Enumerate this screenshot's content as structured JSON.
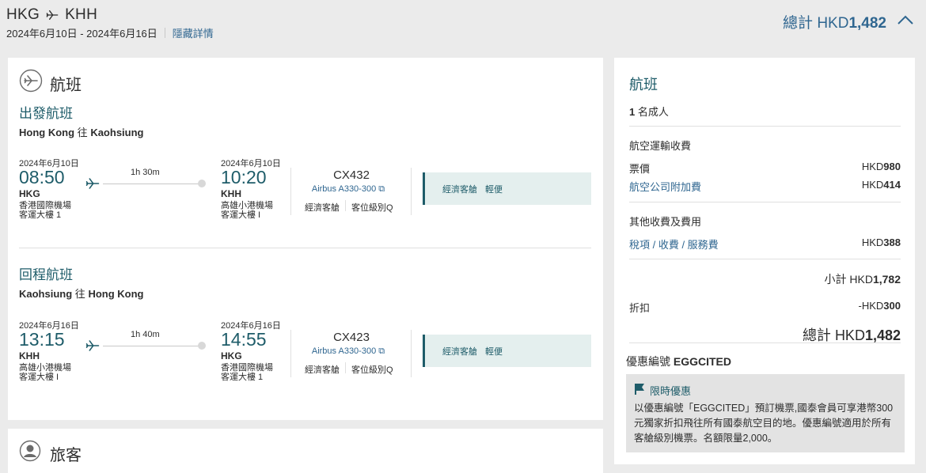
{
  "header": {
    "origin": "HKG",
    "destination": "KHH",
    "date_range": "2024年6月10日 - 2024年6月16日",
    "hide_details_link": "隱藏詳情",
    "total_label": "總計 HKD",
    "total_amount": "1,482"
  },
  "flights_section": {
    "title": "航班",
    "outbound": {
      "title": "出發航班",
      "from": "Hong Kong",
      "connector": "往",
      "to": "Kaohsiung",
      "dep_date": "2024年6月10日",
      "dep_time": "08:50",
      "dep_code": "HKG",
      "dep_airport": "香港國際機場",
      "dep_terminal": "客運大樓 1",
      "duration": "1h 30m",
      "arr_date": "2024年6月10日",
      "arr_time": "10:20",
      "arr_code": "KHH",
      "arr_airport": "高雄小港機場",
      "arr_terminal": "客運大樓 I",
      "flight_no": "CX432",
      "aircraft": "Airbus A330-300",
      "cabin": "經濟客艙",
      "booking_class": "客位級別Q",
      "fare_cabin": "經濟客艙",
      "fare_brand": "輕便"
    },
    "inbound": {
      "title": "回程航班",
      "from": "Kaohsiung",
      "connector": "往",
      "to": "Hong Kong",
      "dep_date": "2024年6月16日",
      "dep_time": "13:15",
      "dep_code": "KHH",
      "dep_airport": "高雄小港機場",
      "dep_terminal": "客運大樓 I",
      "duration": "1h 40m",
      "arr_date": "2024年6月16日",
      "arr_time": "14:55",
      "arr_code": "HKG",
      "arr_airport": "香港國際機場",
      "arr_terminal": "客運大樓 1",
      "flight_no": "CX423",
      "aircraft": "Airbus A330-300",
      "cabin": "經濟客艙",
      "booking_class": "客位級別Q",
      "fare_cabin": "經濟客艙",
      "fare_brand": "輕便"
    }
  },
  "passengers_section": {
    "title": "旅客"
  },
  "summary": {
    "title": "航班",
    "adults_count": "1",
    "adults_label": "名成人",
    "air_transport_heading": "航空運輸收費",
    "fare_label": "票價",
    "fare_currency": "HKD",
    "fare_value": "980",
    "surcharge_label": "航空公司附加費",
    "surcharge_currency": "HKD",
    "surcharge_value": "414",
    "other_heading": "其他收費及費用",
    "taxes_label": "稅項 / 收費 / 服務費",
    "taxes_currency": "HKD",
    "taxes_value": "388",
    "subtotal_label": "小計 HKD",
    "subtotal_value": "1,782",
    "discount_label": "折扣",
    "discount_currency": "-HKD",
    "discount_value": "300",
    "total_label": "總計 HKD",
    "total_value": "1,482",
    "promo_code_label": "優惠編號",
    "promo_code": "EGGCITED",
    "promo_heading": "限時優惠",
    "promo_text": "以優惠編號「EGGCITED」預訂機票,國泰會員可享港幣300元獨家折扣飛往所有國泰航空目的地。優惠編號適用於所有客艙級別機票。名額限量2,000。"
  },
  "colors": {
    "brand_teal": "#1e5c69",
    "link_blue": "#2f6690",
    "fare_bg": "#e4efee",
    "page_bg": "#ebebeb"
  },
  "icons": [
    "plane-icon",
    "chevron-up-icon",
    "flight-section-icon",
    "passenger-icon",
    "aircraft-info-icon",
    "flag-icon"
  ]
}
